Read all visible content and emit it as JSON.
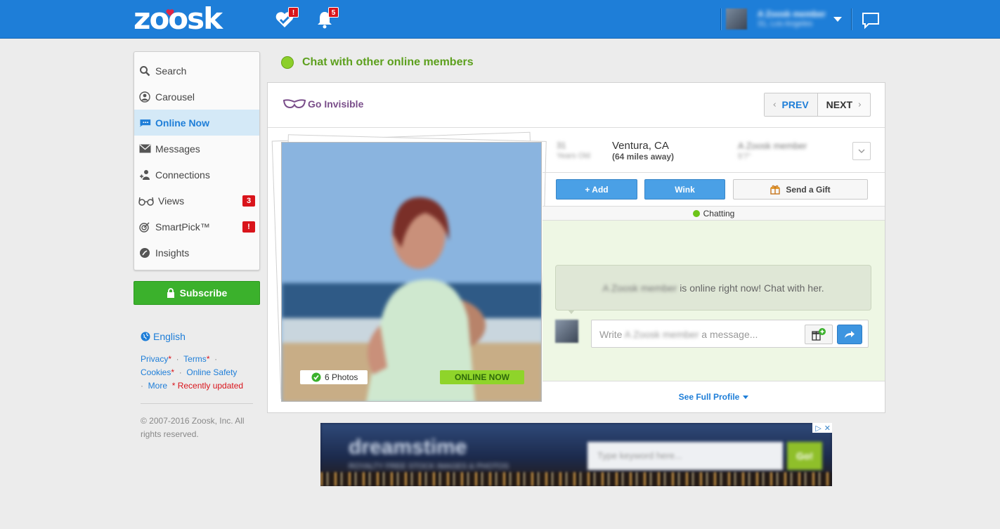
{
  "header": {
    "logo_text": "zoosk",
    "matches_badge": "!",
    "notifications_badge": "5",
    "user_name": "A Zoosk member",
    "user_location": "31, Los Angeles"
  },
  "sidebar": {
    "items": [
      {
        "label": "Search",
        "icon": "search-icon"
      },
      {
        "label": "Carousel",
        "icon": "carousel-icon"
      },
      {
        "label": "Online Now",
        "icon": "chat-bubble-icon"
      },
      {
        "label": "Messages",
        "icon": "envelope-icon"
      },
      {
        "label": "Connections",
        "icon": "connections-icon"
      },
      {
        "label": "Views",
        "icon": "glasses-icon",
        "badge": "3"
      },
      {
        "label": "SmartPick™",
        "icon": "target-icon",
        "badge": "!"
      },
      {
        "label": "Insights",
        "icon": "insights-icon"
      }
    ],
    "active": "Online Now",
    "subscribe_label": "Subscribe",
    "language": "English",
    "footer_links": {
      "privacy": "Privacy",
      "terms": "Terms",
      "cookies": "Cookies",
      "online_safety": "Online Safety",
      "more": "More",
      "recently_updated": "* Recently updated"
    },
    "copyright": "© 2007-2016 Zoosk, Inc. All rights reserved."
  },
  "main": {
    "chat_header": "Chat with other online members",
    "go_invisible": "Go Invisible",
    "prev_label": "PREV",
    "next_label": "NEXT",
    "photos_label": "6 Photos",
    "online_now_label": "ONLINE NOW",
    "profile": {
      "age": "31",
      "age_label": "Years Old",
      "city": "Ventura, CA",
      "distance": "(64 miles away)",
      "member_name": "A Zoosk member",
      "member_sub": "5'7\""
    },
    "actions": {
      "add_label": "+ Add",
      "wink_label": "Wink",
      "gift_label": "Send a Gift"
    },
    "chat_status": "Chatting",
    "online_message_name": "A Zoosk member",
    "online_message_rest": "is online right now! Chat with her.",
    "message_placeholder_prefix": "Write",
    "message_placeholder_name": "A Zoosk member",
    "message_placeholder_suffix": "a message...",
    "see_full_profile": "See Full Profile"
  },
  "ad": {
    "brand": "dreamstime",
    "tagline": "ROYALTY FREE STOCK IMAGES & PHOTOS",
    "search_placeholder": "Type keyword here...",
    "go_label": "Go!",
    "close_label": "✕"
  },
  "colors": {
    "brand_blue": "#1e7ed8",
    "online_green": "#8ccf2a",
    "subscribe_green": "#3bb12c",
    "badge_red": "#d9141b"
  }
}
